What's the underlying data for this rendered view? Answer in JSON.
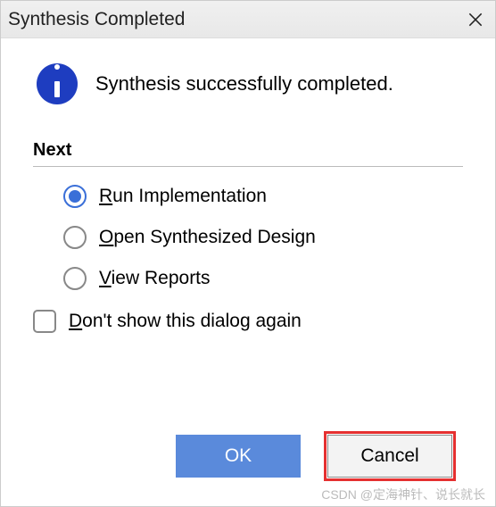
{
  "title": "Synthesis Completed",
  "message": "Synthesis successfully completed.",
  "next_label": "Next",
  "options": {
    "run_impl": "Run Implementation",
    "open_design": "Open Synthesized Design",
    "view_reports": "View Reports"
  },
  "checkbox_label": "Don't show this dialog again",
  "buttons": {
    "ok": "OK",
    "cancel": "Cancel"
  },
  "watermark": "CSDN @定海神针、说长就长"
}
